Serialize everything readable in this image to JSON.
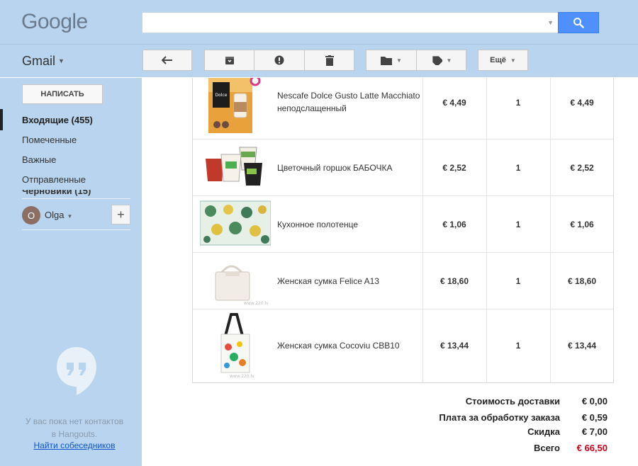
{
  "header": {
    "logo": "Google",
    "search": {
      "value": "",
      "placeholder": ""
    }
  },
  "toolbar": {
    "app_label": "Gmail",
    "more_label": "Ещё"
  },
  "sidebar": {
    "compose_label": "НАПИСАТЬ",
    "items": [
      {
        "label": "Входящие (455)",
        "active": true
      },
      {
        "label": "Помеченные"
      },
      {
        "label": "Важные"
      },
      {
        "label": "Отправленные"
      },
      {
        "label": "Черновики (15)"
      }
    ],
    "user": {
      "initial": "O",
      "name": "Olga"
    },
    "hangouts": {
      "empty_text_1": "У вас пока нет контактов",
      "empty_text_2": "в Hangouts.",
      "link": "Найти собеседников"
    }
  },
  "order": {
    "items": [
      {
        "name": "Nescafe Dolce Gusto Latte Macchiato неподслащенный",
        "price": "€ 4,49",
        "qty": "1",
        "total": "€ 4,49",
        "icon": "coffee-box"
      },
      {
        "name": "Цветочный горшок БАБОЧКА",
        "price": "€ 2,52",
        "qty": "1",
        "total": "€ 2,52",
        "icon": "flower-pots"
      },
      {
        "name": "Кухонное полотенце",
        "price": "€ 1,06",
        "qty": "1",
        "total": "€ 1,06",
        "icon": "kitchen-towel"
      },
      {
        "name": "Женская сумка Felice A13",
        "price": "€ 18,60",
        "qty": "1",
        "total": "€ 18,60",
        "icon": "white-handbag"
      },
      {
        "name": "Женская сумка Cocoviu CBB10",
        "price": "€ 13,44",
        "qty": "1",
        "total": "€ 13,44",
        "icon": "floral-bag"
      }
    ],
    "summary": [
      {
        "label": "Стоимость доставки",
        "value": "€ 0,00"
      },
      {
        "label": "Плата за обработку заказа",
        "value": "€ 0,59"
      },
      {
        "label": "Скидка",
        "value": "€ 7,00"
      },
      {
        "label": "Всего",
        "value": "€ 66,50",
        "accent": "#d0021b"
      }
    ]
  },
  "colors": {
    "header_bg": "#b9d4ee",
    "search_button": "#4d90fe",
    "total_accent": "#d0021b",
    "link": "#1155cc"
  }
}
